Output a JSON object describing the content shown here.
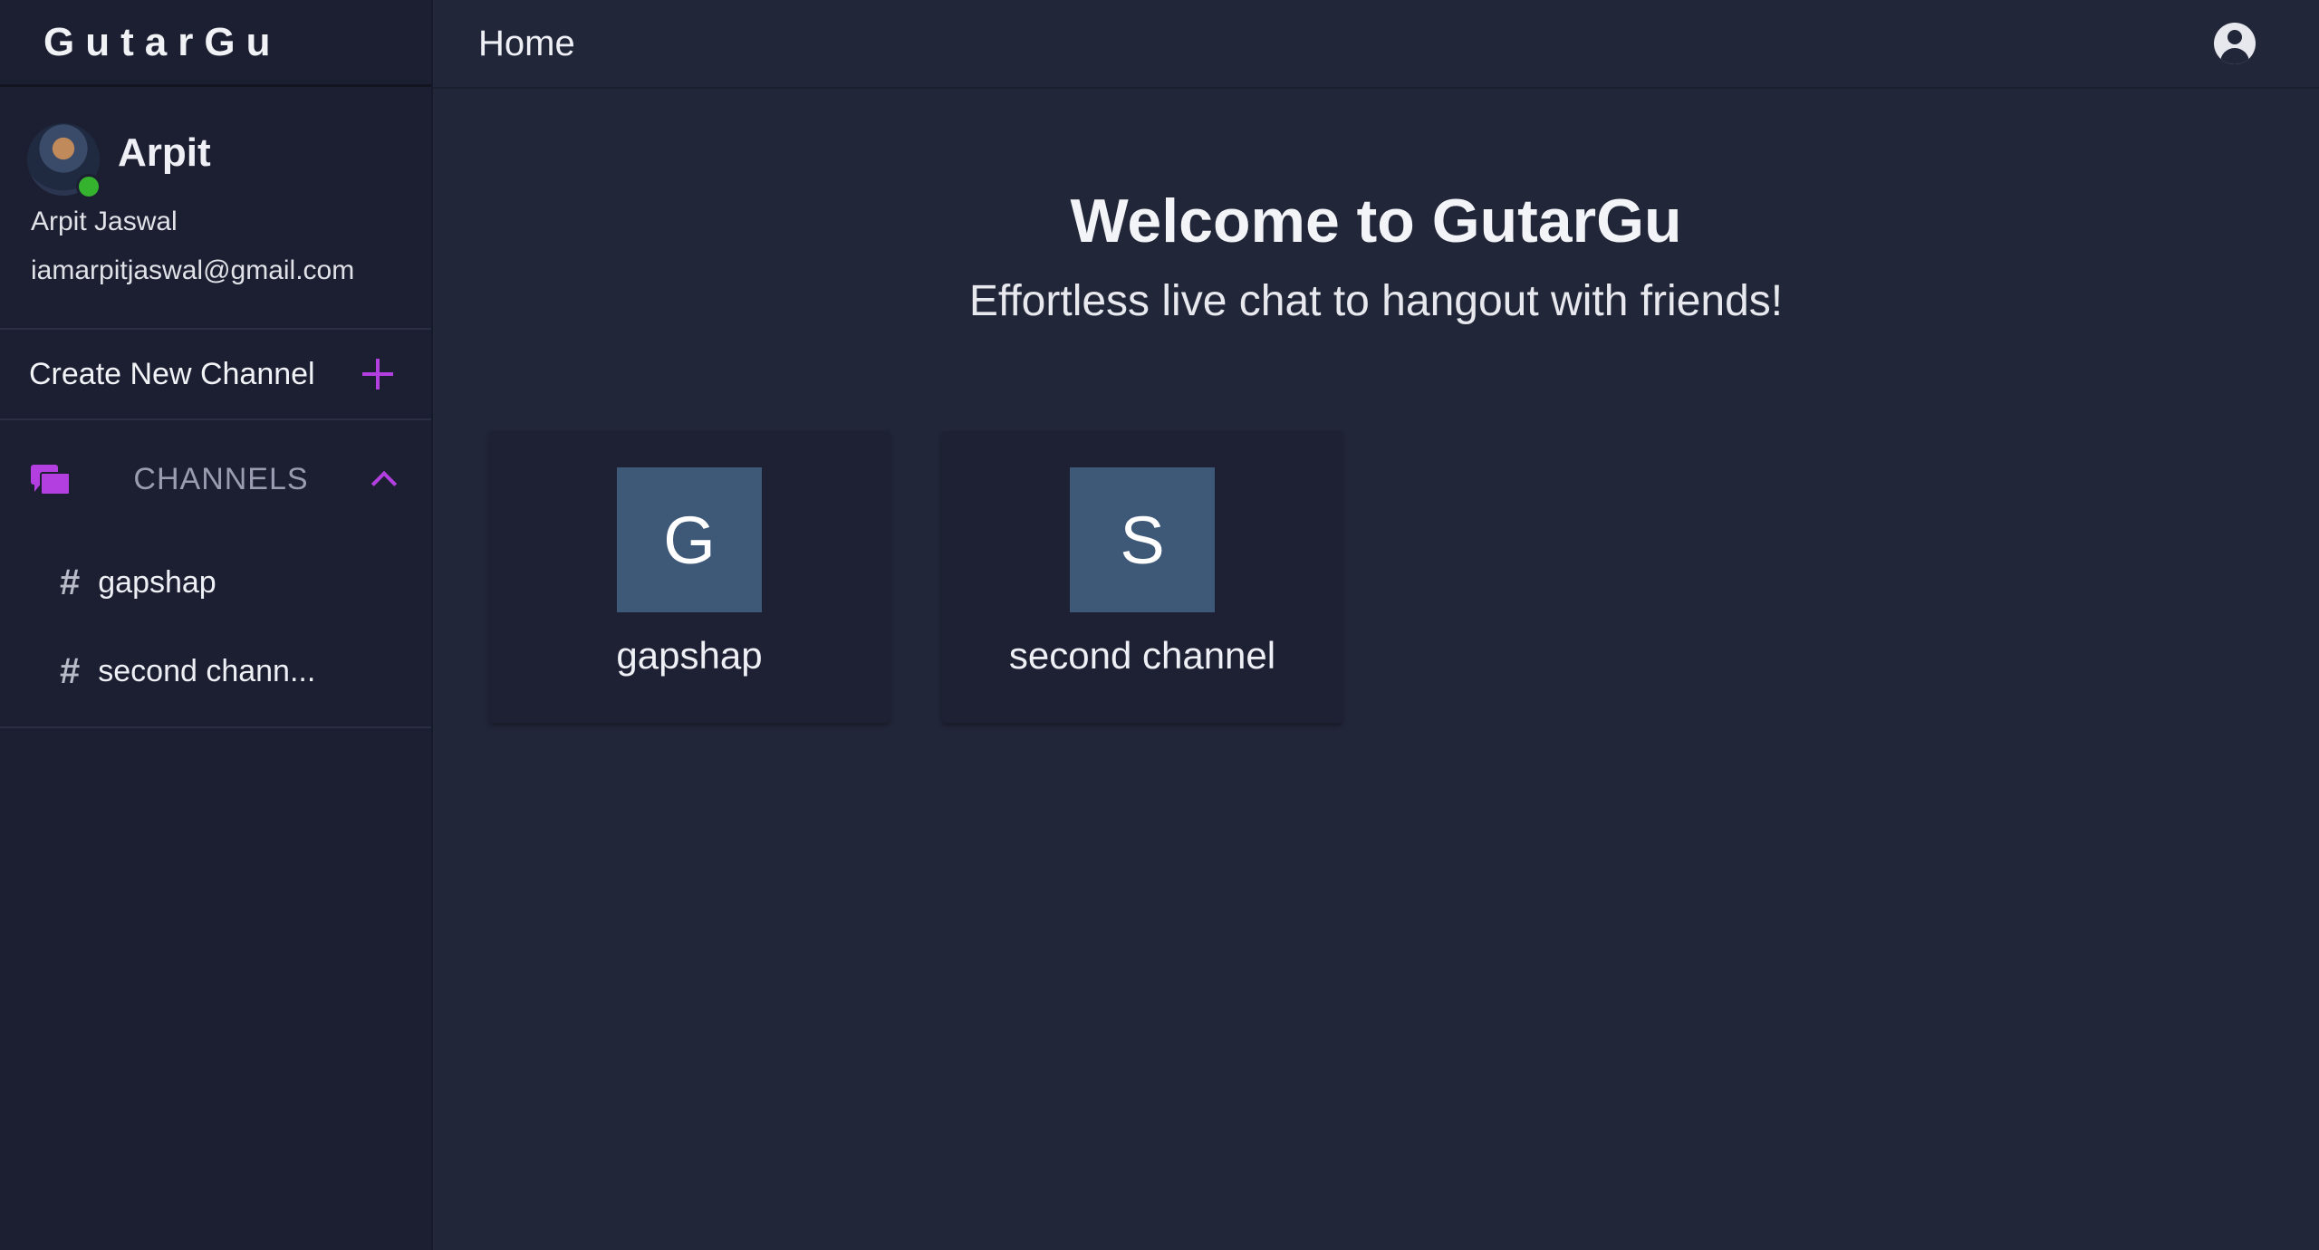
{
  "app": {
    "brand": "GutarGu"
  },
  "user": {
    "display_name": "Arpit",
    "full_name": "Arpit Jaswal",
    "email": "iamarpitjaswal@gmail.com",
    "status": "online"
  },
  "sidebar": {
    "create_label": "Create New Channel",
    "channels_label": "CHANNELS",
    "channels": [
      {
        "label": "gapshap"
      },
      {
        "label": "second chann..."
      }
    ]
  },
  "topbar": {
    "title": "Home"
  },
  "main": {
    "heading": "Welcome to GutarGu",
    "subheading": "Effortless live chat to hangout with friends!",
    "cards": [
      {
        "initial": "G",
        "name": "gapshap"
      },
      {
        "initial": "S",
        "name": "second channel"
      }
    ]
  },
  "colors": {
    "accent": "#b43fe0",
    "background": "#222639",
    "sidebar": "#1b1f31",
    "tile": "#3e5878",
    "online": "#35b22e"
  }
}
